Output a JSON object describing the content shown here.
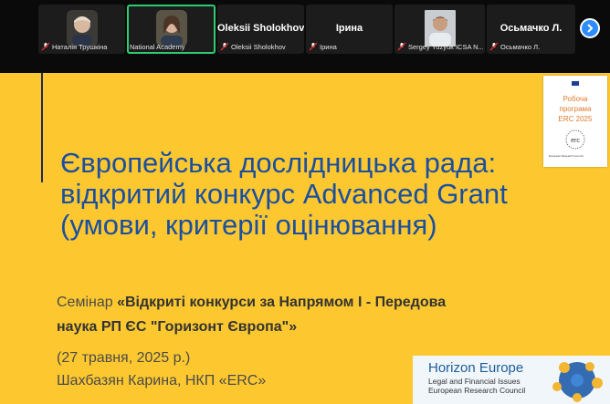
{
  "participants": [
    {
      "display_name": "Наталія Трушкіна",
      "has_video": true
    },
    {
      "display_name": "National Academy",
      "has_video": true,
      "active_speaker": true
    },
    {
      "display_name": "Oleksii Sholokhov",
      "big_name": "Oleksii Sholokhov",
      "has_video": false
    },
    {
      "display_name": "Ірина",
      "big_name": "Ірина",
      "has_video": false
    },
    {
      "display_name": "Sergey Yuzyuk ICSA N...",
      "has_video": true
    },
    {
      "display_name": "Осьмачко Л.",
      "big_name": "Осьмачко Л.",
      "has_video": false
    }
  ],
  "slide": {
    "title_line1": "Європейська дослідницька рада:",
    "title_line2": "відкритий конкурс Advanced Grant",
    "title_line3": "(умови, критерії оцінювання)",
    "seminar_prefix": "Семінар ",
    "seminar_line1": "«Відкриті конкурси за Напрямом І - Передова",
    "seminar_line2": "наука РП ЄС \"Горизонт Європа\"»",
    "date": "(27 травня, 2025 р.)",
    "author": "Шахбазян Карина, НКП «ERC»",
    "erc_card": {
      "line1": "Робоча",
      "line2": "програма",
      "line3": "ERC 2025",
      "logo_text": "erc",
      "small_text": "European Research Council"
    },
    "banner": {
      "title": "Horizon Europe",
      "sub1": "Legal and Financial Issues",
      "sub2": "European Research Council"
    }
  },
  "colors": {
    "slide_bg": "#fdc82f",
    "title": "#1b4fa0",
    "active_tile_border": "#2ecc71",
    "next_button": "#2d8cff"
  }
}
